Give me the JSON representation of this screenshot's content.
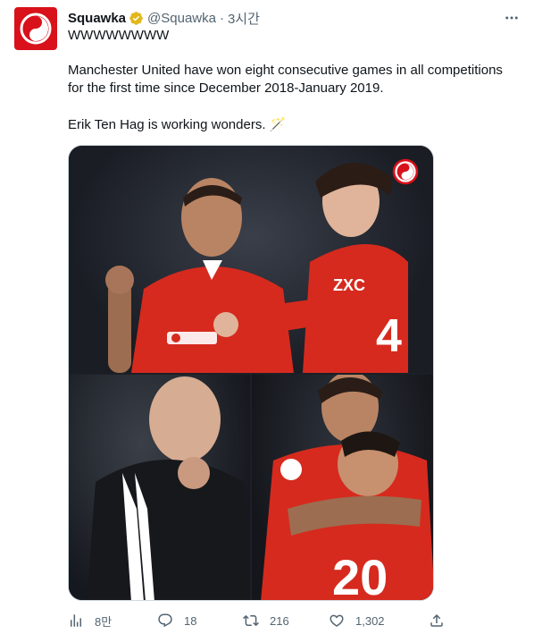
{
  "author": {
    "display_name": "Squawka",
    "handle": "@Squawka",
    "separator": "·",
    "time": "3시간"
  },
  "tweet": {
    "line1": "WWWWWWWW",
    "line2a": "Manchester United have won eight consecutive games in all competitions",
    "line2b": "for the first time since December 2018-January 2019.",
    "line3": "Erik Ten Hag is working wonders. 🪄"
  },
  "actions": {
    "views": "8만",
    "replies": "18",
    "retweets": "216",
    "likes": "1,302"
  },
  "icons": {
    "avatar": "squawka-logo-icon",
    "verified": "verified-badge-icon",
    "more": "more-icon",
    "views": "analytics-icon",
    "reply": "reply-icon",
    "retweet": "retweet-icon",
    "like": "heart-icon",
    "share": "share-icon"
  },
  "colors": {
    "brand": "#d8111b",
    "verified": "#e2b719",
    "muted": "#536471",
    "text": "#0f1419"
  }
}
